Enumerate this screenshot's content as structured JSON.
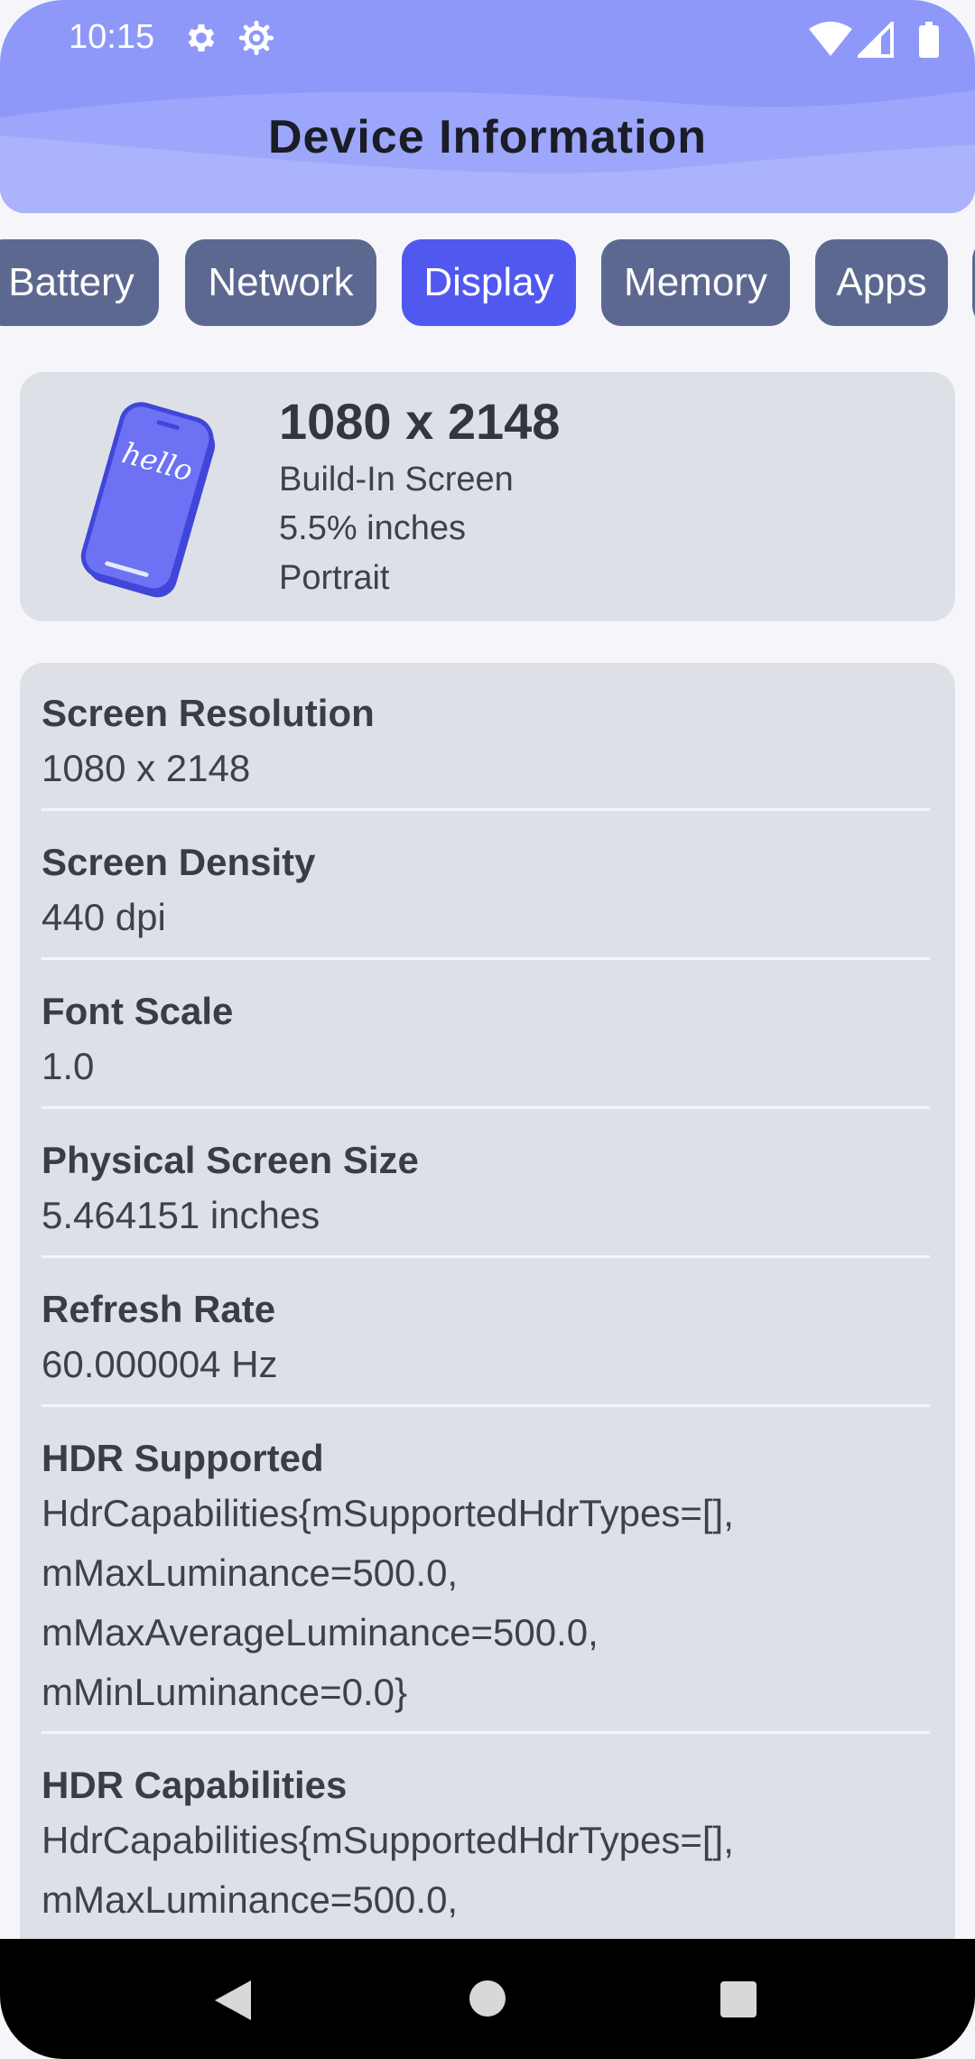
{
  "status_bar": {
    "time": "10:15",
    "icons": [
      "gear-icon",
      "gear-outline-icon",
      "wifi-icon",
      "signal-icon",
      "battery-icon"
    ]
  },
  "header": {
    "title": "Device Information",
    "color": "#8d98f9"
  },
  "tabs": [
    {
      "label": "Battery",
      "active": false
    },
    {
      "label": "Network",
      "active": false
    },
    {
      "label": "Display",
      "active": true
    },
    {
      "label": "Memory",
      "active": false
    },
    {
      "label": "Apps",
      "active": false
    }
  ],
  "summary": {
    "illustration_text": "hello",
    "resolution": "1080 x 2148",
    "screen_type": "Build-In Screen",
    "size": "5.5% inches",
    "orientation": "Portrait"
  },
  "details": [
    {
      "label": "Screen Resolution",
      "value": "1080 x 2148"
    },
    {
      "label": "Screen Density",
      "value": "440 dpi"
    },
    {
      "label": "Font Scale",
      "value": "1.0"
    },
    {
      "label": "Physical Screen Size",
      "value": "5.464151 inches"
    },
    {
      "label": "Refresh Rate",
      "value": "60.000004 Hz"
    },
    {
      "label": "HDR Supported",
      "value_lines": [
        "HdrCapabilities{mSupportedHdrTypes=[],",
        "mMaxLuminance=500.0,",
        "mMaxAverageLuminance=500.0,",
        "mMinLuminance=0.0}"
      ]
    },
    {
      "label": "HDR Capabilities",
      "value_lines": [
        "HdrCapabilities{mSupportedHdrTypes=[],",
        "mMaxLuminance=500.0,"
      ]
    }
  ],
  "colors": {
    "accent": "#5158f0",
    "tab_inactive": "#5d6890",
    "card": "#dde1e7"
  }
}
